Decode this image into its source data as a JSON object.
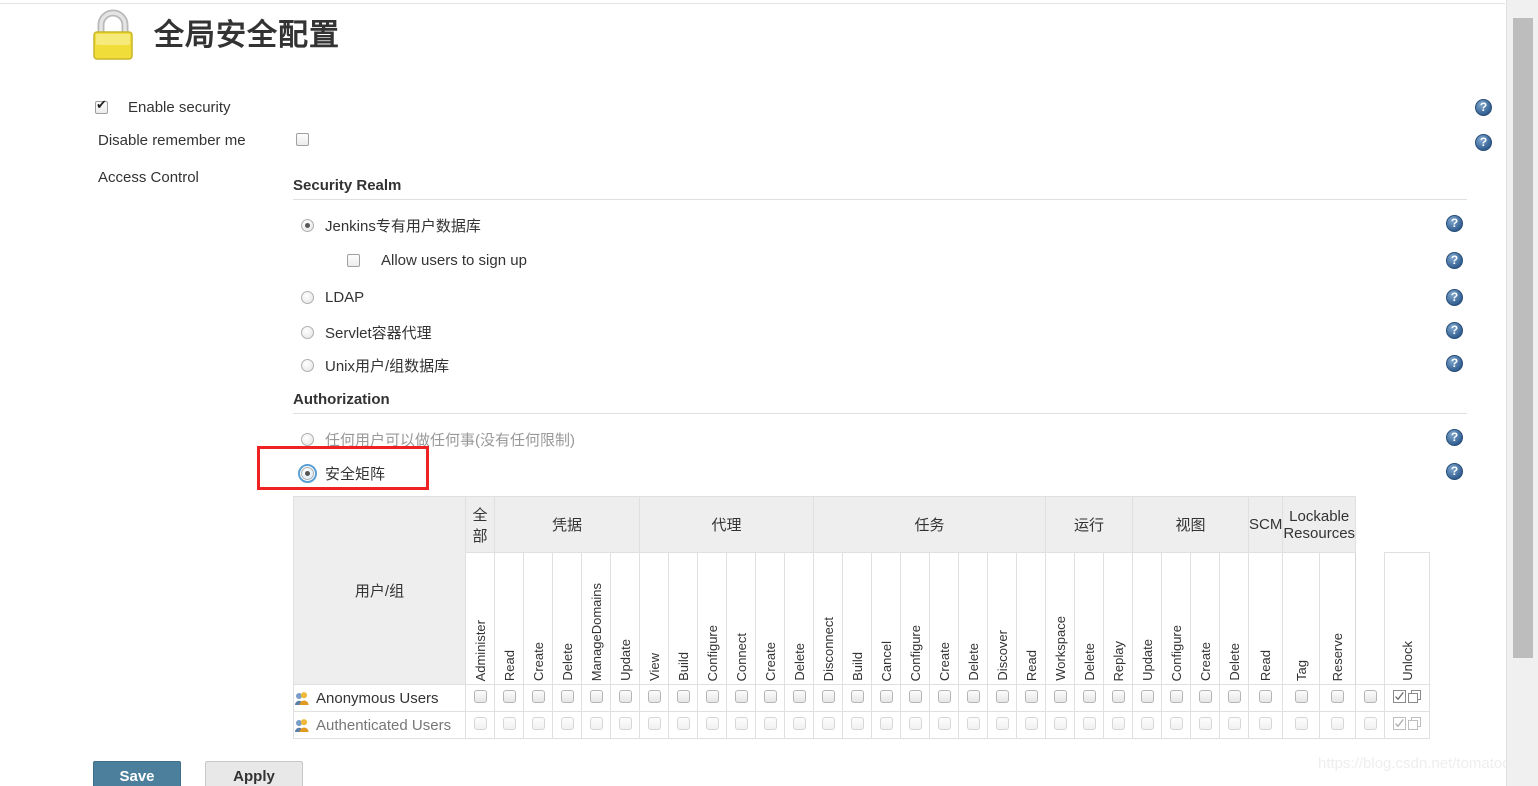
{
  "page": {
    "title": "全局安全配置",
    "lock_icon": "padlock-icon",
    "watermark": "https://blog.csdn.net/tomatocc"
  },
  "options": {
    "enable_security": {
      "label": "Enable security",
      "checked": true
    },
    "disable_remember_me": {
      "label": "Disable remember me",
      "checked": false
    },
    "access_control": {
      "label": "Access Control"
    }
  },
  "security_realm": {
    "title": "Security Realm",
    "options": [
      {
        "label": "Jenkins专有用户数据库",
        "selected": true
      },
      {
        "label": "LDAP",
        "selected": false
      },
      {
        "label": "Servlet容器代理",
        "selected": false
      },
      {
        "label": "Unix用户/组数据库",
        "selected": false
      }
    ],
    "allow_signup": {
      "label": "Allow users to sign up",
      "checked": false
    }
  },
  "authorization": {
    "title": "Authorization",
    "options": [
      {
        "label": "任何用户可以做任何事(没有任何限制)",
        "selected": false
      },
      {
        "label": "安全矩阵",
        "selected": true,
        "highlighted": true
      }
    ]
  },
  "matrix": {
    "user_group_header": "用户/组",
    "groups": [
      {
        "label": "全部",
        "cols": 1
      },
      {
        "label": "凭据",
        "cols": 5
      },
      {
        "label": "代理",
        "cols": 6
      },
      {
        "label": "任务",
        "cols": 8
      },
      {
        "label": "运行",
        "cols": 3
      },
      {
        "label": "视图",
        "cols": 4
      },
      {
        "label": "SCM",
        "cols": 1
      },
      {
        "label": "Lockable Resources",
        "cols": 2
      }
    ],
    "columns": [
      "Administer",
      "Read",
      "Create",
      "Delete",
      "ManageDomains",
      "Update",
      "View",
      "Build",
      "Configure",
      "Connect",
      "Create",
      "Delete",
      "Disconnect",
      "Build",
      "Cancel",
      "Configure",
      "Create",
      "Delete",
      "Discover",
      "Read",
      "Workspace",
      "Delete",
      "Replay",
      "Update",
      "Configure",
      "Create",
      "Delete",
      "Read",
      "Tag",
      "Reserve",
      "Unlock"
    ],
    "rows": [
      {
        "name": "Anonymous Users",
        "icon": "user-group-icon",
        "dim": false,
        "checked": [
          false,
          false,
          false,
          false,
          false,
          false,
          false,
          false,
          false,
          false,
          false,
          false,
          false,
          false,
          false,
          false,
          false,
          false,
          false,
          false,
          false,
          false,
          false,
          false,
          false,
          false,
          false,
          false,
          false,
          false,
          false
        ],
        "actions": [
          "select-all-icon",
          "copy-row-icon"
        ]
      },
      {
        "name": "Authenticated Users",
        "icon": "user-group-icon",
        "dim": true,
        "checked": [
          false,
          false,
          false,
          false,
          false,
          false,
          false,
          false,
          false,
          false,
          false,
          false,
          false,
          false,
          false,
          false,
          false,
          false,
          false,
          false,
          false,
          false,
          false,
          false,
          false,
          false,
          false,
          false,
          false,
          false,
          false
        ],
        "actions": [
          "select-all-icon",
          "copy-row-icon"
        ]
      }
    ]
  },
  "help_icons_count": 8,
  "buttons": {
    "save": "Save",
    "apply": "Apply"
  },
  "colors": {
    "accent": "#4c7f9c",
    "highlight": "#ee2222",
    "help": "#2f5c8f",
    "lock": "#f2e04a"
  }
}
